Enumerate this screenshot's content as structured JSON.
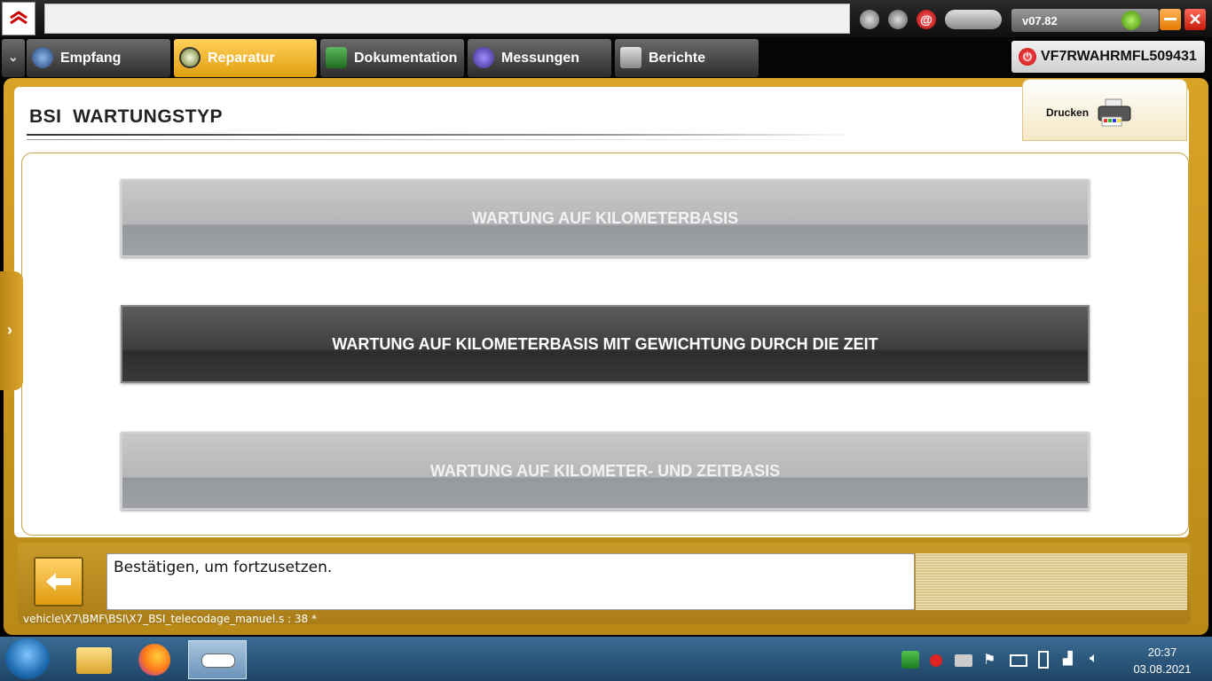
{
  "address_value": "",
  "version": "v07.82",
  "tabs": [
    {
      "label": "Empfang",
      "icon": "globe-icon"
    },
    {
      "label": "Reparatur",
      "icon": "magnifier-icon"
    },
    {
      "label": "Dokumentation",
      "icon": "book-icon"
    },
    {
      "label": "Messungen",
      "icon": "waveform-icon"
    },
    {
      "label": "Berichte",
      "icon": "document-icon"
    }
  ],
  "active_tab": "Reparatur",
  "vin": "VF7RWAHRMFL509431",
  "page_title": "BSI  WARTUNGSTYP",
  "print_label": "Drucken",
  "options": [
    {
      "label": "WARTUNG AUF KILOMETERBASIS",
      "state": "disabled"
    },
    {
      "label": "WARTUNG AUF KILOMETERBASIS MIT GEWICHTUNG DURCH DIE ZEIT",
      "state": "selected"
    },
    {
      "label": "WARTUNG AUF KILOMETER- UND ZEITBASIS",
      "state": "disabled"
    }
  ],
  "message": "Bestätigen, um fortzusetzen.",
  "script_path": "vehicle\\X7\\BMF\\BSI\\X7_BSI_telecodage_manuel.s : 38 *",
  "clock": {
    "time": "20:37",
    "date": "03.08.2021"
  },
  "colors": {
    "accent": "#dba52b",
    "selected_option": "#3d3d3d",
    "disabled_option": "#b5b6b8"
  }
}
